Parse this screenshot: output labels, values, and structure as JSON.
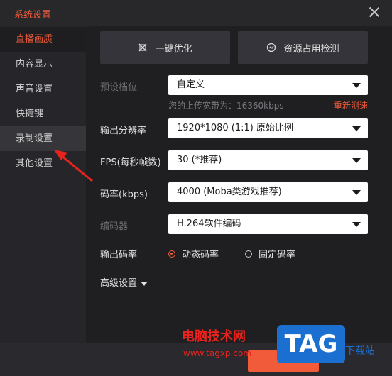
{
  "window": {
    "title": "系统设置"
  },
  "sidebar": {
    "items": [
      {
        "label": "直播画质"
      },
      {
        "label": "内容显示"
      },
      {
        "label": "声音设置"
      },
      {
        "label": "快捷键"
      },
      {
        "label": "录制设置"
      },
      {
        "label": "其他设置"
      }
    ]
  },
  "toolbar": {
    "optimize_label": "一键优化",
    "resource_label": "资源占用检测"
  },
  "form": {
    "preset": {
      "label": "预设档位",
      "value": "自定义"
    },
    "bandwidth_hint": "您的上传宽带为：16360kbps",
    "retest_label": "重新测速",
    "resolution": {
      "label": "输出分辨率",
      "value": "1920*1080 (1:1) 原始比例"
    },
    "fps": {
      "label": "FPS(每秒帧数)",
      "value": "30 (*推荐)"
    },
    "bitrate": {
      "label": "码率(kbps)",
      "value": "4000 (Moba类游戏推荐)"
    },
    "encoder": {
      "label": "编码器",
      "value": "H.264软件编码"
    },
    "rate_mode": {
      "label": "输出码率",
      "options": [
        {
          "label": "动态码率",
          "selected": true
        },
        {
          "label": "固定码率",
          "selected": false
        }
      ]
    },
    "advanced_label": "高级设置"
  },
  "watermark": {
    "site_name": "电脑技术网",
    "url": "www.tagxp.com",
    "logo": "TAG",
    "download": "下载站"
  },
  "colors": {
    "accent": "#f15b3a",
    "background": "#1f1f22",
    "sidebar": "#26262a"
  }
}
